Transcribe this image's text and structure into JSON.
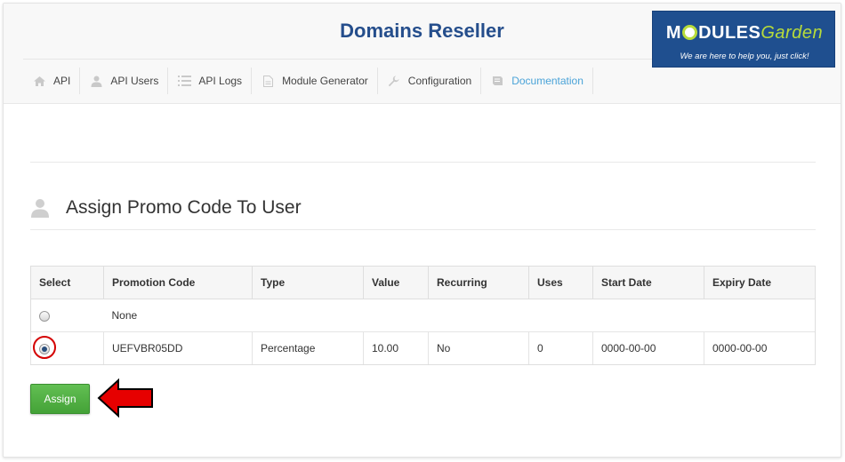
{
  "app": {
    "title": "Domains Reseller"
  },
  "logo": {
    "name_part1": "M",
    "name_part2": "DULES",
    "name_accent": "Garden",
    "tagline": "We are here to help you, just click!"
  },
  "nav": [
    {
      "label": "API",
      "icon": "home-icon",
      "active": false
    },
    {
      "label": "API Users",
      "icon": "user-icon",
      "active": false
    },
    {
      "label": "API Logs",
      "icon": "list-icon",
      "active": false
    },
    {
      "label": "Module Generator",
      "icon": "document-icon",
      "active": false
    },
    {
      "label": "Configuration",
      "icon": "wrench-icon",
      "active": false
    },
    {
      "label": "Documentation",
      "icon": "book-icon",
      "active": true
    }
  ],
  "section": {
    "title": "Assign Promo Code To User",
    "icon": "user-icon"
  },
  "table": {
    "headers": [
      "Select",
      "Promotion Code",
      "Type",
      "Value",
      "Recurring",
      "Uses",
      "Start Date",
      "Expiry Date"
    ],
    "none_label": "None",
    "rows": [
      {
        "code": "UEFVBR05DD",
        "type": "Percentage",
        "value": "10.00",
        "recurring": "No",
        "uses": "0",
        "start": "0000-00-00",
        "expiry": "0000-00-00",
        "selected": true
      }
    ]
  },
  "actions": {
    "assign_label": "Assign"
  },
  "colors": {
    "title": "#254e8c",
    "active_nav": "#4aa3d8",
    "button": "#4aab3c",
    "highlight": "#d40000"
  }
}
